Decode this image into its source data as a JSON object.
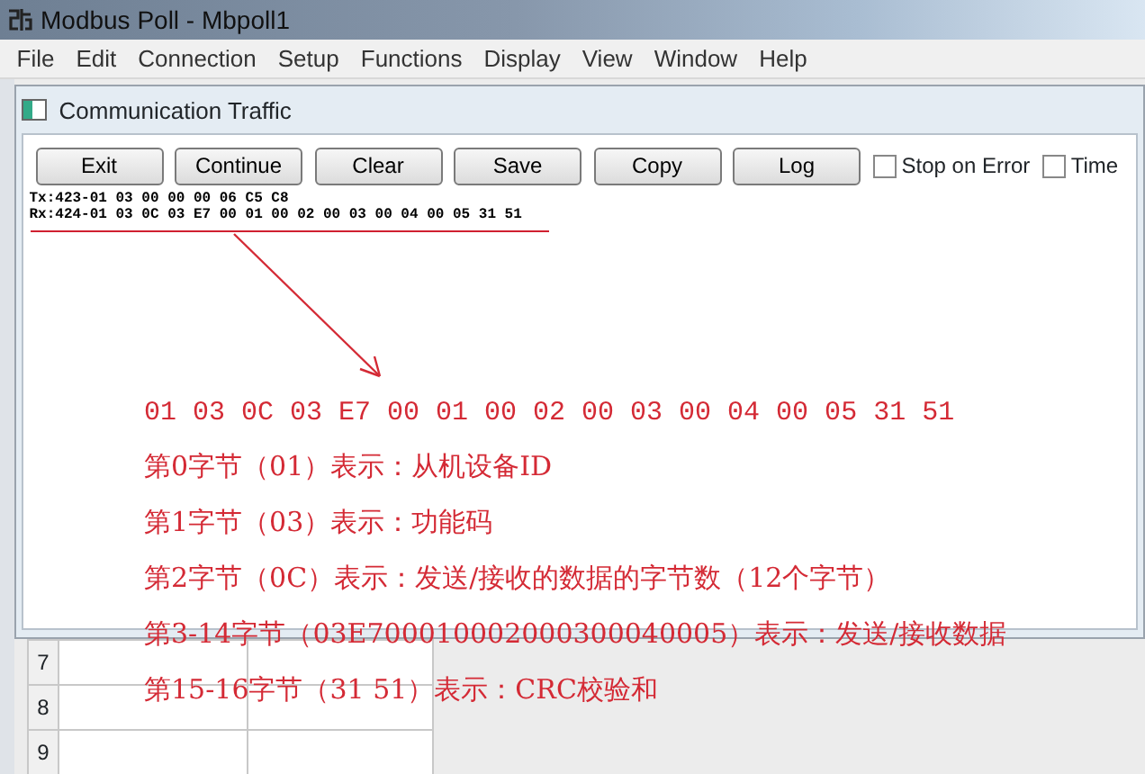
{
  "window": {
    "title": "Modbus Poll - Mbpoll1"
  },
  "menu": [
    "File",
    "Edit",
    "Connection",
    "Setup",
    "Functions",
    "Display",
    "View",
    "Window",
    "Help"
  ],
  "traffic_window": {
    "title": "Communication Traffic",
    "buttons": [
      "Exit",
      "Continue",
      "Clear",
      "Save",
      "Copy",
      "Log"
    ],
    "checkboxes": [
      {
        "label": "Stop on Error",
        "checked": false
      },
      {
        "label": "Time",
        "checked": false
      }
    ],
    "lines": [
      "Tx:423-01 03 00 00 00 06 C5 C8",
      "Rx:424-01 03 0C 03 E7 00 01 00 02 00 03 00 04 00 05 31 51"
    ]
  },
  "grid": {
    "rows": [
      "7",
      "8",
      "9"
    ]
  },
  "annotation": {
    "hex": "01 03 0C 03 E7 00 01 00 02 00 03 00 04 00 05 31 51",
    "notes": [
      "第0字节（01）表示：从机设备ID",
      "第1字节（03）表示：功能码",
      "第2字节（0C）表示：发送/接收的数据的字节数（12个字节）",
      "第3-14字节（03E700010002000300040005）表示：发送/接收数据",
      "第15-16字节（31 51）表示：CRC校验和"
    ]
  }
}
